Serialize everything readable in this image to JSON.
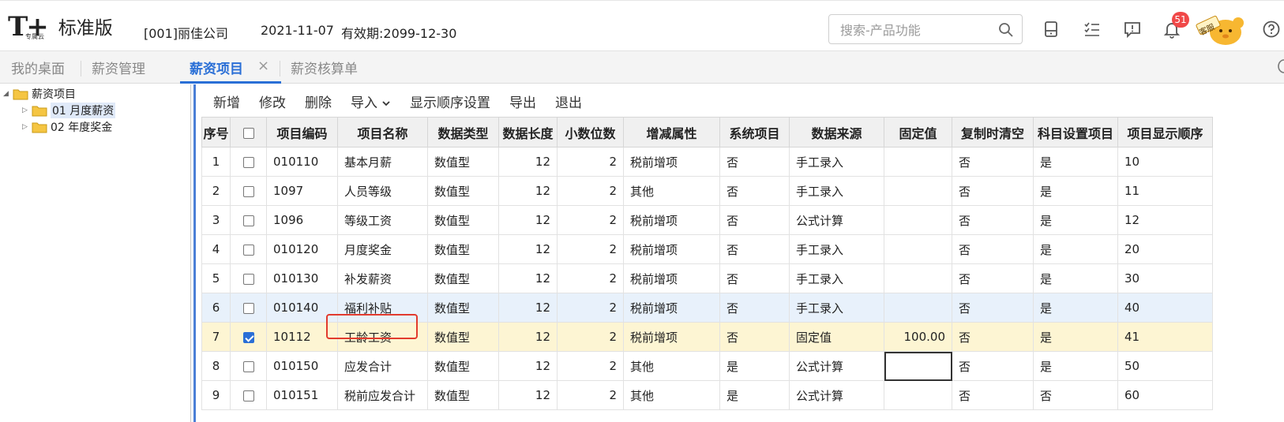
{
  "header": {
    "logo_mark": "T+",
    "logo_subtitle": "专属云",
    "edition": "标准版",
    "company": "[001]丽佳公司",
    "date": "2021-11-07",
    "validity": "有效期:2099-12-30",
    "search_placeholder": "搜索-产品功能",
    "notification_count": "51",
    "service_label": "客服"
  },
  "tabs": [
    {
      "label": "我的桌面"
    },
    {
      "label": "薪资管理"
    },
    {
      "label": "薪资项目",
      "active": true
    },
    {
      "label": "薪资核算单"
    }
  ],
  "tab_close": "×",
  "tree": {
    "root": "薪资项目",
    "children": [
      {
        "label": "01 月度薪资"
      },
      {
        "label": "02 年度奖金"
      }
    ]
  },
  "toolbar": {
    "add": "新增",
    "edit": "修改",
    "delete": "删除",
    "import": "导入",
    "display_order": "显示顺序设置",
    "export": "导出",
    "exit": "退出"
  },
  "grid": {
    "headers": [
      "序号",
      "",
      "项目编码",
      "项目名称",
      "数据类型",
      "数据长度",
      "小数位数",
      "增减属性",
      "系统项目",
      "数据来源",
      "固定值",
      "复制时清空",
      "科目设置项目",
      "项目显示顺序"
    ],
    "rows": [
      {
        "no": "1",
        "checked": false,
        "code": "010110",
        "name": "基本月薪",
        "type": "数值型",
        "length": "12",
        "decimals": "2",
        "attr": "税前增项",
        "system": "否",
        "source": "手工录入",
        "fixed": "",
        "clear": "否",
        "subject": "是",
        "order": "10"
      },
      {
        "no": "2",
        "checked": false,
        "code": "1097",
        "name": "人员等级",
        "type": "数值型",
        "length": "12",
        "decimals": "2",
        "attr": "其他",
        "system": "否",
        "source": "手工录入",
        "fixed": "",
        "clear": "否",
        "subject": "是",
        "order": "11"
      },
      {
        "no": "3",
        "checked": false,
        "code": "1096",
        "name": "等级工资",
        "type": "数值型",
        "length": "12",
        "decimals": "2",
        "attr": "税前增项",
        "system": "否",
        "source": "公式计算",
        "fixed": "",
        "clear": "否",
        "subject": "是",
        "order": "12"
      },
      {
        "no": "4",
        "checked": false,
        "code": "010120",
        "name": "月度奖金",
        "type": "数值型",
        "length": "12",
        "decimals": "2",
        "attr": "税前增项",
        "system": "否",
        "source": "手工录入",
        "fixed": "",
        "clear": "否",
        "subject": "是",
        "order": "20"
      },
      {
        "no": "5",
        "checked": false,
        "code": "010130",
        "name": "补发薪资",
        "type": "数值型",
        "length": "12",
        "decimals": "2",
        "attr": "税前增项",
        "system": "否",
        "source": "手工录入",
        "fixed": "",
        "clear": "否",
        "subject": "是",
        "order": "30"
      },
      {
        "no": "6",
        "checked": false,
        "code": "010140",
        "name": "福利补贴",
        "type": "数值型",
        "length": "12",
        "decimals": "2",
        "attr": "税前增项",
        "system": "否",
        "source": "手工录入",
        "fixed": "",
        "clear": "否",
        "subject": "是",
        "order": "40"
      },
      {
        "no": "7",
        "checked": true,
        "code": "10112",
        "name": "工龄工资",
        "type": "数值型",
        "length": "12",
        "decimals": "2",
        "attr": "税前增项",
        "system": "否",
        "source": "固定值",
        "fixed": "100.00",
        "clear": "否",
        "subject": "是",
        "order": "41"
      },
      {
        "no": "8",
        "checked": false,
        "code": "010150",
        "name": "应发合计",
        "type": "数值型",
        "length": "12",
        "decimals": "2",
        "attr": "其他",
        "system": "是",
        "source": "公式计算",
        "fixed": "",
        "clear": "否",
        "subject": "是",
        "order": "50"
      },
      {
        "no": "9",
        "checked": false,
        "code": "010151",
        "name": "税前应发合计",
        "type": "数值型",
        "length": "12",
        "decimals": "2",
        "attr": "其他",
        "system": "是",
        "source": "公式计算",
        "fixed": "",
        "clear": "否",
        "subject": "否",
        "order": "60"
      }
    ]
  },
  "colors": {
    "accent": "#2a6fd6",
    "hover_row": "#e8f1fb",
    "selected_row": "#fdf5d3",
    "annotation_red": "#e23b2e",
    "badge_red": "#f04848"
  }
}
